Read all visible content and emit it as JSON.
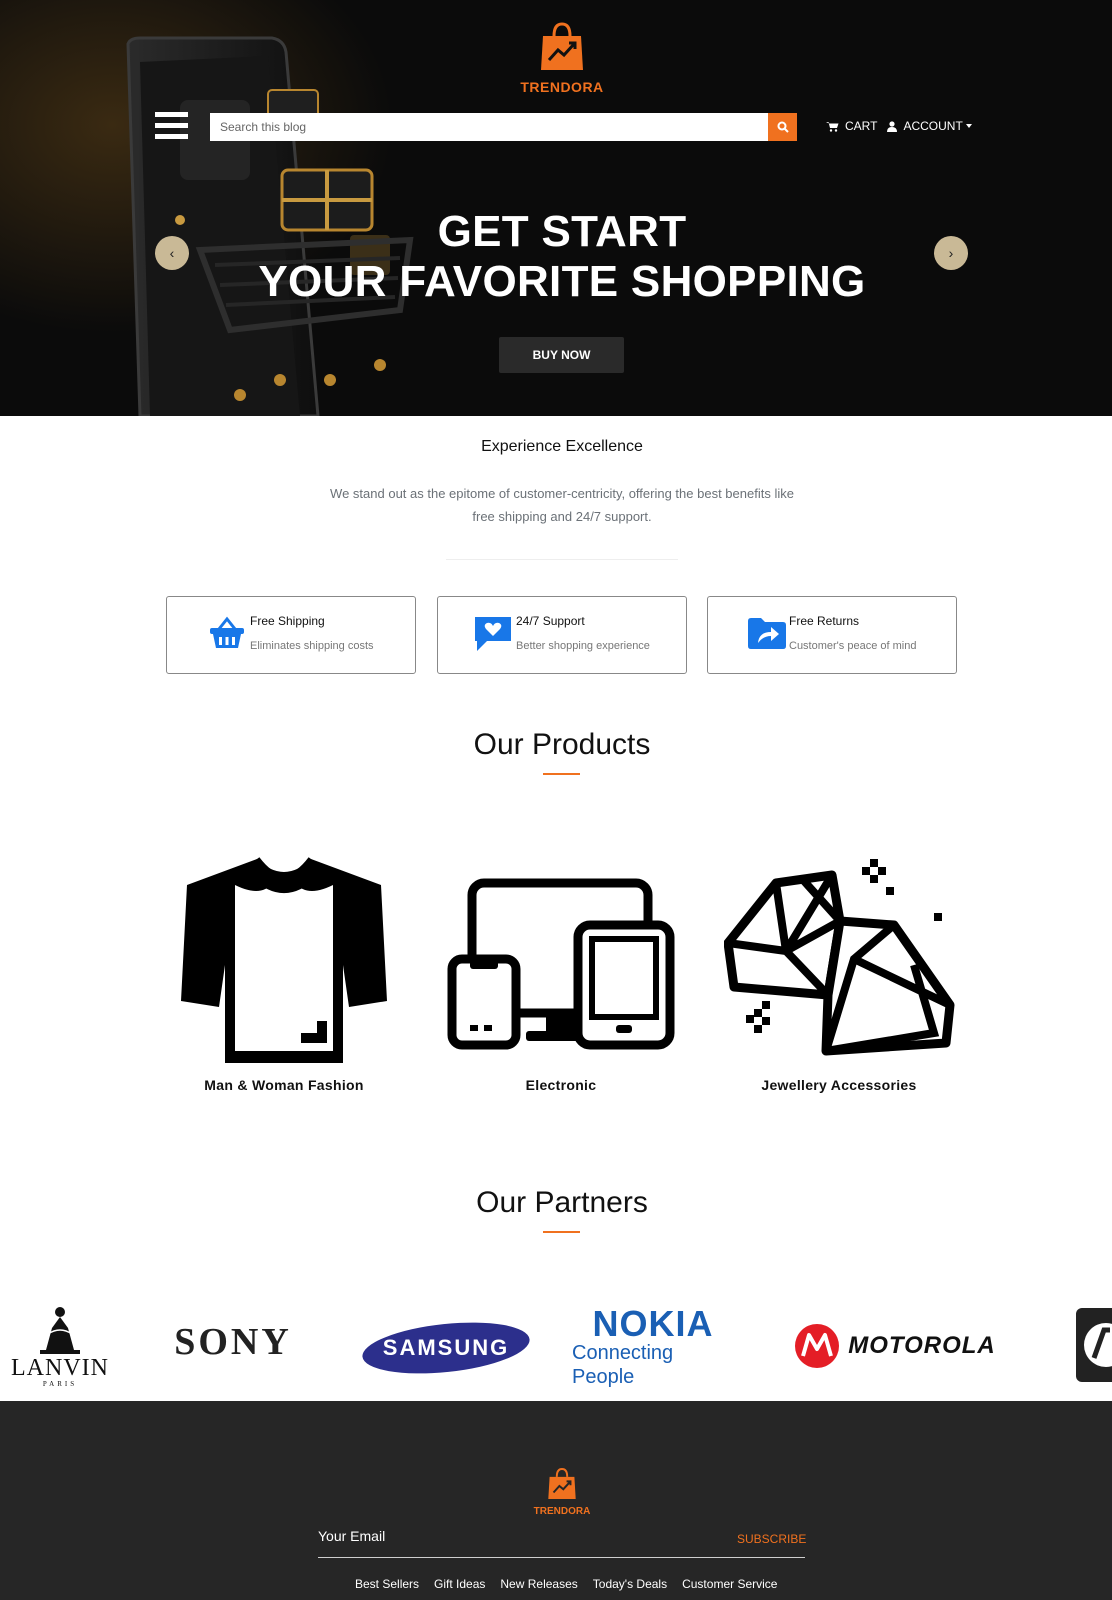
{
  "brand": {
    "name": "TRENDORA",
    "accent_color": "#f0711f"
  },
  "header": {
    "search_placeholder": "Search this blog",
    "cart_label": "CART",
    "account_label": "ACCOUNT",
    "menu_icon": "hamburger-icon",
    "search_icon": "search-icon"
  },
  "hero": {
    "title_line1": "GET START",
    "title_line2": "YOUR FAVORITE SHOPPING",
    "button_label": "BUY NOW",
    "prev_symbol": "‹",
    "next_symbol": "›"
  },
  "excellence": {
    "title": "Experience Excellence",
    "text": "We stand out as the epitome of customer-centricity, offering the best benefits like free shipping and 24/7 support."
  },
  "features": [
    {
      "title": "Free Shipping",
      "subtitle": "Eliminates shipping costs",
      "icon": "basket-icon"
    },
    {
      "title": "24/7 Support",
      "subtitle": "Better shopping experience",
      "icon": "chat-heart-icon"
    },
    {
      "title": "Free Returns",
      "subtitle": "Customer's peace of mind",
      "icon": "folder-share-icon"
    }
  ],
  "products": {
    "title": "Our Products",
    "items": [
      {
        "label": "Man & Woman Fashion",
        "icon": "tshirt-icon"
      },
      {
        "label": "Electronic",
        "icon": "devices-icon"
      },
      {
        "label": "Jewellery Accessories",
        "icon": "diamond-icon"
      }
    ]
  },
  "partners": {
    "title": "Our Partners",
    "logos": [
      {
        "text": "LANVIN",
        "sub": "PARIS"
      },
      {
        "text": "SONY"
      },
      {
        "text": "SAMSUNG"
      },
      {
        "text": "NOKIA",
        "sub": "Connecting People"
      },
      {
        "text": "MOTOROLA"
      }
    ]
  },
  "footer": {
    "email_label": "Your Email",
    "subscribe_label": "SUBSCRIBE",
    "links": [
      "Best Sellers",
      "Gift Ideas",
      "New Releases",
      "Today's Deals",
      "Customer Service"
    ]
  }
}
